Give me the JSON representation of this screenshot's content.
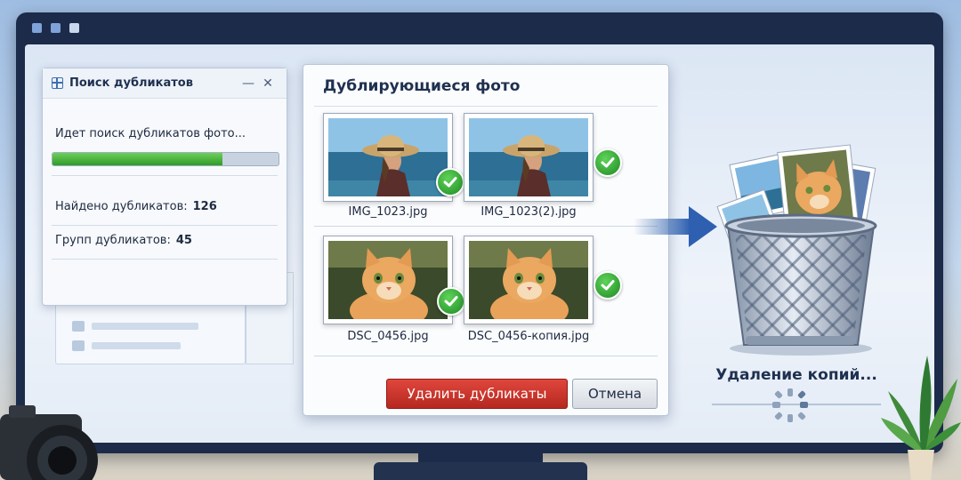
{
  "search_dialog": {
    "title": "Поиск дубликатов",
    "minimize": "—",
    "close": "✕",
    "status": "Идет поиск дубликатов фото...",
    "progress": 0.75,
    "found_label": "Найдено дубликатов:",
    "found_value": "126",
    "groups_label": "Групп дубликатов:",
    "groups_value": "45"
  },
  "dups_dialog": {
    "title": "Дублирующиеся фото",
    "files": [
      {
        "name": "IMG_1023.jpg",
        "kind": "woman-beach"
      },
      {
        "name": "IMG_1023(2).jpg",
        "kind": "woman-beach"
      },
      {
        "name": "DSC_0456.jpg",
        "kind": "cat"
      },
      {
        "name": "DSC_0456-копия.jpg",
        "kind": "cat"
      }
    ],
    "delete_label": "Удалить дубликаты",
    "cancel_label": "Отмена"
  },
  "deleting": {
    "label": "Удаление копий..."
  },
  "colors": {
    "accent": "#3e6fb0",
    "delete": "#c8322a",
    "check": "#2e9e2f",
    "progress": "#3fae36"
  }
}
